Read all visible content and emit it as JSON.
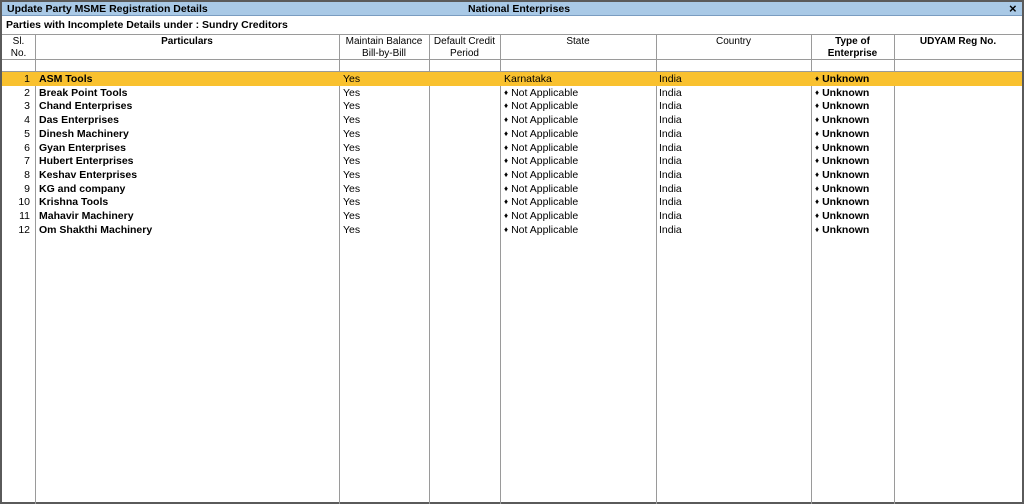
{
  "window": {
    "title": "Update Party MSME Registration Details",
    "company": "National Enterprises",
    "close_glyph": "×"
  },
  "subheader": "Parties with Incomplete Details under : Sundry Creditors",
  "columns": {
    "sl": [
      "Sl.",
      "No."
    ],
    "particulars": "Particulars",
    "maintain": [
      "Maintain Balance",
      "Bill-by-Bill"
    ],
    "credit": [
      "Default Credit",
      "Period"
    ],
    "state": "State",
    "country": "Country",
    "enterprise": [
      "Type of",
      "Enterprise"
    ],
    "udyam": "UDYAM Reg No."
  },
  "rows": [
    {
      "sl": "1",
      "name": "ASM Tools",
      "bill": "Yes",
      "state": "Karnataka",
      "state_marker": "",
      "country": "India",
      "enterprise": "Unknown",
      "selected": true
    },
    {
      "sl": "2",
      "name": "Break Point Tools",
      "bill": "Yes",
      "state": "Not Applicable",
      "state_marker": "♦",
      "country": "India",
      "enterprise": "Unknown"
    },
    {
      "sl": "3",
      "name": "Chand Enterprises",
      "bill": "Yes",
      "state": "Not Applicable",
      "state_marker": "♦",
      "country": "India",
      "enterprise": "Unknown"
    },
    {
      "sl": "4",
      "name": "Das Enterprises",
      "bill": "Yes",
      "state": "Not Applicable",
      "state_marker": "♦",
      "country": "India",
      "enterprise": "Unknown"
    },
    {
      "sl": "5",
      "name": "Dinesh Machinery",
      "bill": "Yes",
      "state": "Not Applicable",
      "state_marker": "♦",
      "country": "India",
      "enterprise": "Unknown"
    },
    {
      "sl": "6",
      "name": "Gyan Enterprises",
      "bill": "Yes",
      "state": "Not Applicable",
      "state_marker": "♦",
      "country": "India",
      "enterprise": "Unknown"
    },
    {
      "sl": "7",
      "name": "Hubert Enterprises",
      "bill": "Yes",
      "state": "Not Applicable",
      "state_marker": "♦",
      "country": "India",
      "enterprise": "Unknown"
    },
    {
      "sl": "8",
      "name": "Keshav Enterprises",
      "bill": "Yes",
      "state": "Not Applicable",
      "state_marker": "♦",
      "country": "India",
      "enterprise": "Unknown"
    },
    {
      "sl": "9",
      "name": "KG and company",
      "bill": "Yes",
      "state": "Not Applicable",
      "state_marker": "♦",
      "country": "India",
      "enterprise": "Unknown"
    },
    {
      "sl": "10",
      "name": "Krishna Tools",
      "bill": "Yes",
      "state": "Not Applicable",
      "state_marker": "♦",
      "country": "India",
      "enterprise": "Unknown"
    },
    {
      "sl": "11",
      "name": "Mahavir Machinery",
      "bill": "Yes",
      "state": "Not Applicable",
      "state_marker": "♦",
      "country": "India",
      "enterprise": "Unknown"
    },
    {
      "sl": "12",
      "name": "Om Shakthi Machinery",
      "bill": "Yes",
      "state": "Not Applicable",
      "state_marker": "♦",
      "country": "India",
      "enterprise": "Unknown"
    }
  ],
  "colors": {
    "titlebar": "#a9c9e6",
    "selected_row": "#f9c12f",
    "grid": "#9a9a9a"
  }
}
